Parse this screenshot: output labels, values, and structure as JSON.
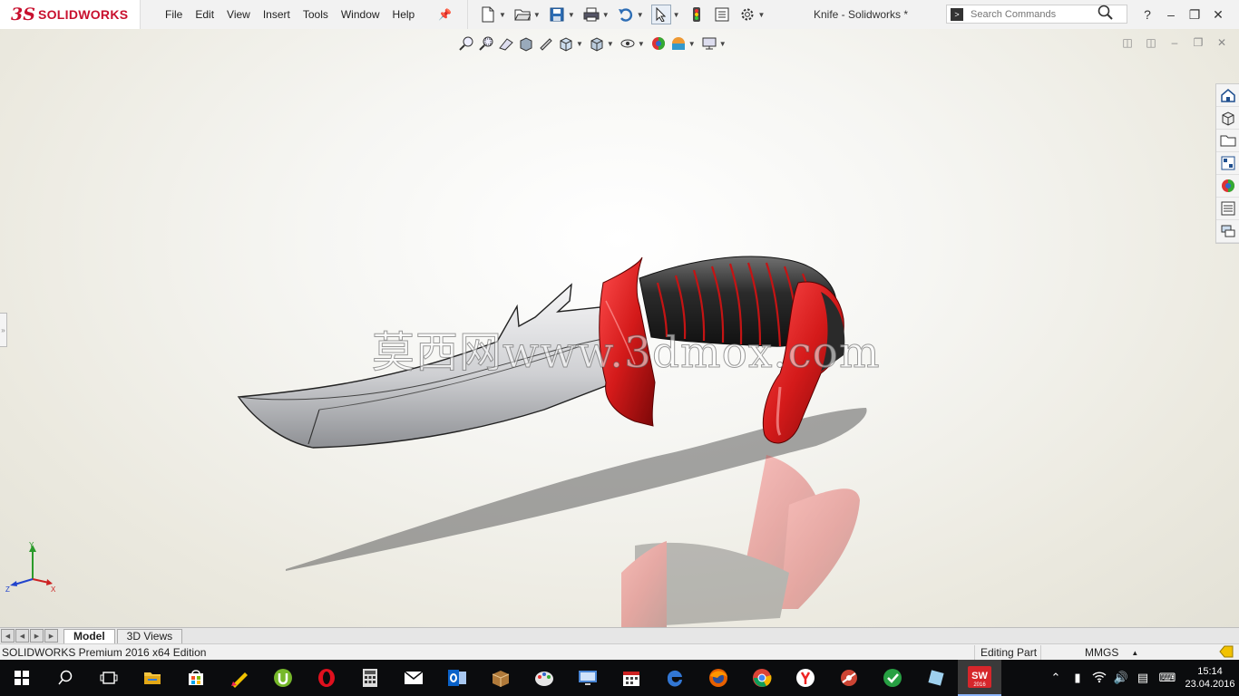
{
  "app": {
    "logo_prefix": "3S",
    "logo_name": "SOLIDWORKS",
    "document_title": "Knife - Solidworks *"
  },
  "menu": [
    "File",
    "Edit",
    "View",
    "Insert",
    "Tools",
    "Window",
    "Help"
  ],
  "search": {
    "placeholder": "Search Commands"
  },
  "viewport": {
    "watermark": "莫西网www.3dmox.com",
    "triad": {
      "y": "Y",
      "x": "X",
      "z": "Z"
    }
  },
  "bottom_tabs": [
    {
      "label": "Model",
      "active": true
    },
    {
      "label": "3D Views",
      "active": false
    }
  ],
  "status": {
    "message": "SOLIDWORKS Premium 2016 x64 Edition",
    "mode": "Editing Part",
    "units": "MMGS"
  },
  "taskbar": {
    "solidworks_badge": "SW",
    "solidworks_badge_year": "2016",
    "time": "15:14",
    "date": "23.04.2016"
  },
  "colors": {
    "brand": "#c8102e",
    "handle_red": "#d41a1a",
    "handle_grip": "#2a2a2a",
    "blade": "#d9dadc",
    "taskbar": "#0b0c0e"
  }
}
